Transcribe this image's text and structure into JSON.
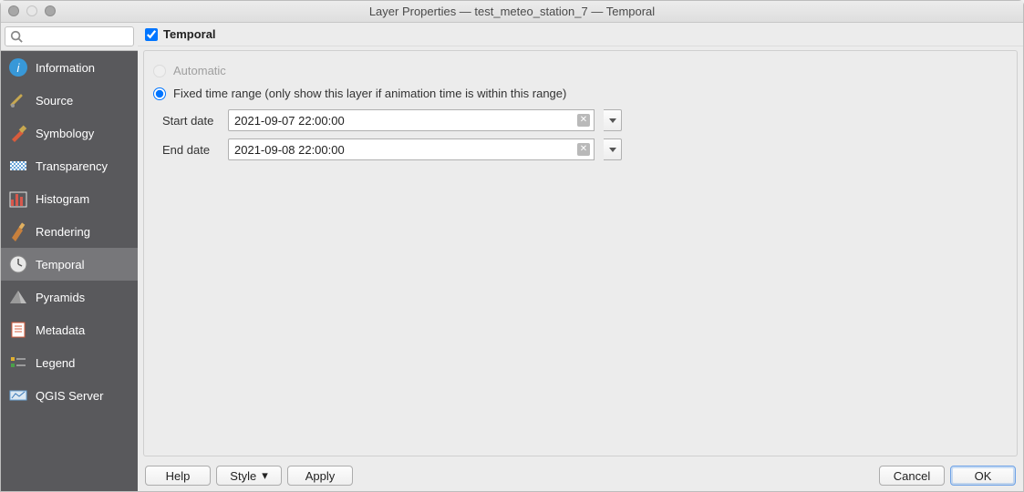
{
  "window": {
    "title": "Layer Properties — test_meteo_station_7 — Temporal"
  },
  "search": {
    "placeholder": ""
  },
  "sidebar": {
    "items": [
      {
        "label": "Information",
        "icon": "info-icon"
      },
      {
        "label": "Source",
        "icon": "wrench-icon"
      },
      {
        "label": "Symbology",
        "icon": "brush-icon"
      },
      {
        "label": "Transparency",
        "icon": "transparency-icon"
      },
      {
        "label": "Histogram",
        "icon": "histogram-icon"
      },
      {
        "label": "Rendering",
        "icon": "rendering-icon"
      },
      {
        "label": "Temporal",
        "icon": "clock-icon",
        "active": true
      },
      {
        "label": "Pyramids",
        "icon": "pyramid-icon"
      },
      {
        "label": "Metadata",
        "icon": "metadata-icon"
      },
      {
        "label": "Legend",
        "icon": "legend-icon"
      },
      {
        "label": "QGIS Server",
        "icon": "server-icon"
      }
    ]
  },
  "panel": {
    "checkbox_checked": true,
    "title": "Temporal",
    "radio_automatic": "Automatic",
    "radio_fixed": "Fixed time range (only show this layer if animation time is within this range)",
    "selected_mode": "fixed",
    "start_label": "Start date",
    "end_label": "End date",
    "start_value": "2021-09-07 22:00:00",
    "end_value": "2021-09-08 22:00:00"
  },
  "buttons": {
    "help": "Help",
    "style": "Style",
    "apply": "Apply",
    "cancel": "Cancel",
    "ok": "OK"
  }
}
